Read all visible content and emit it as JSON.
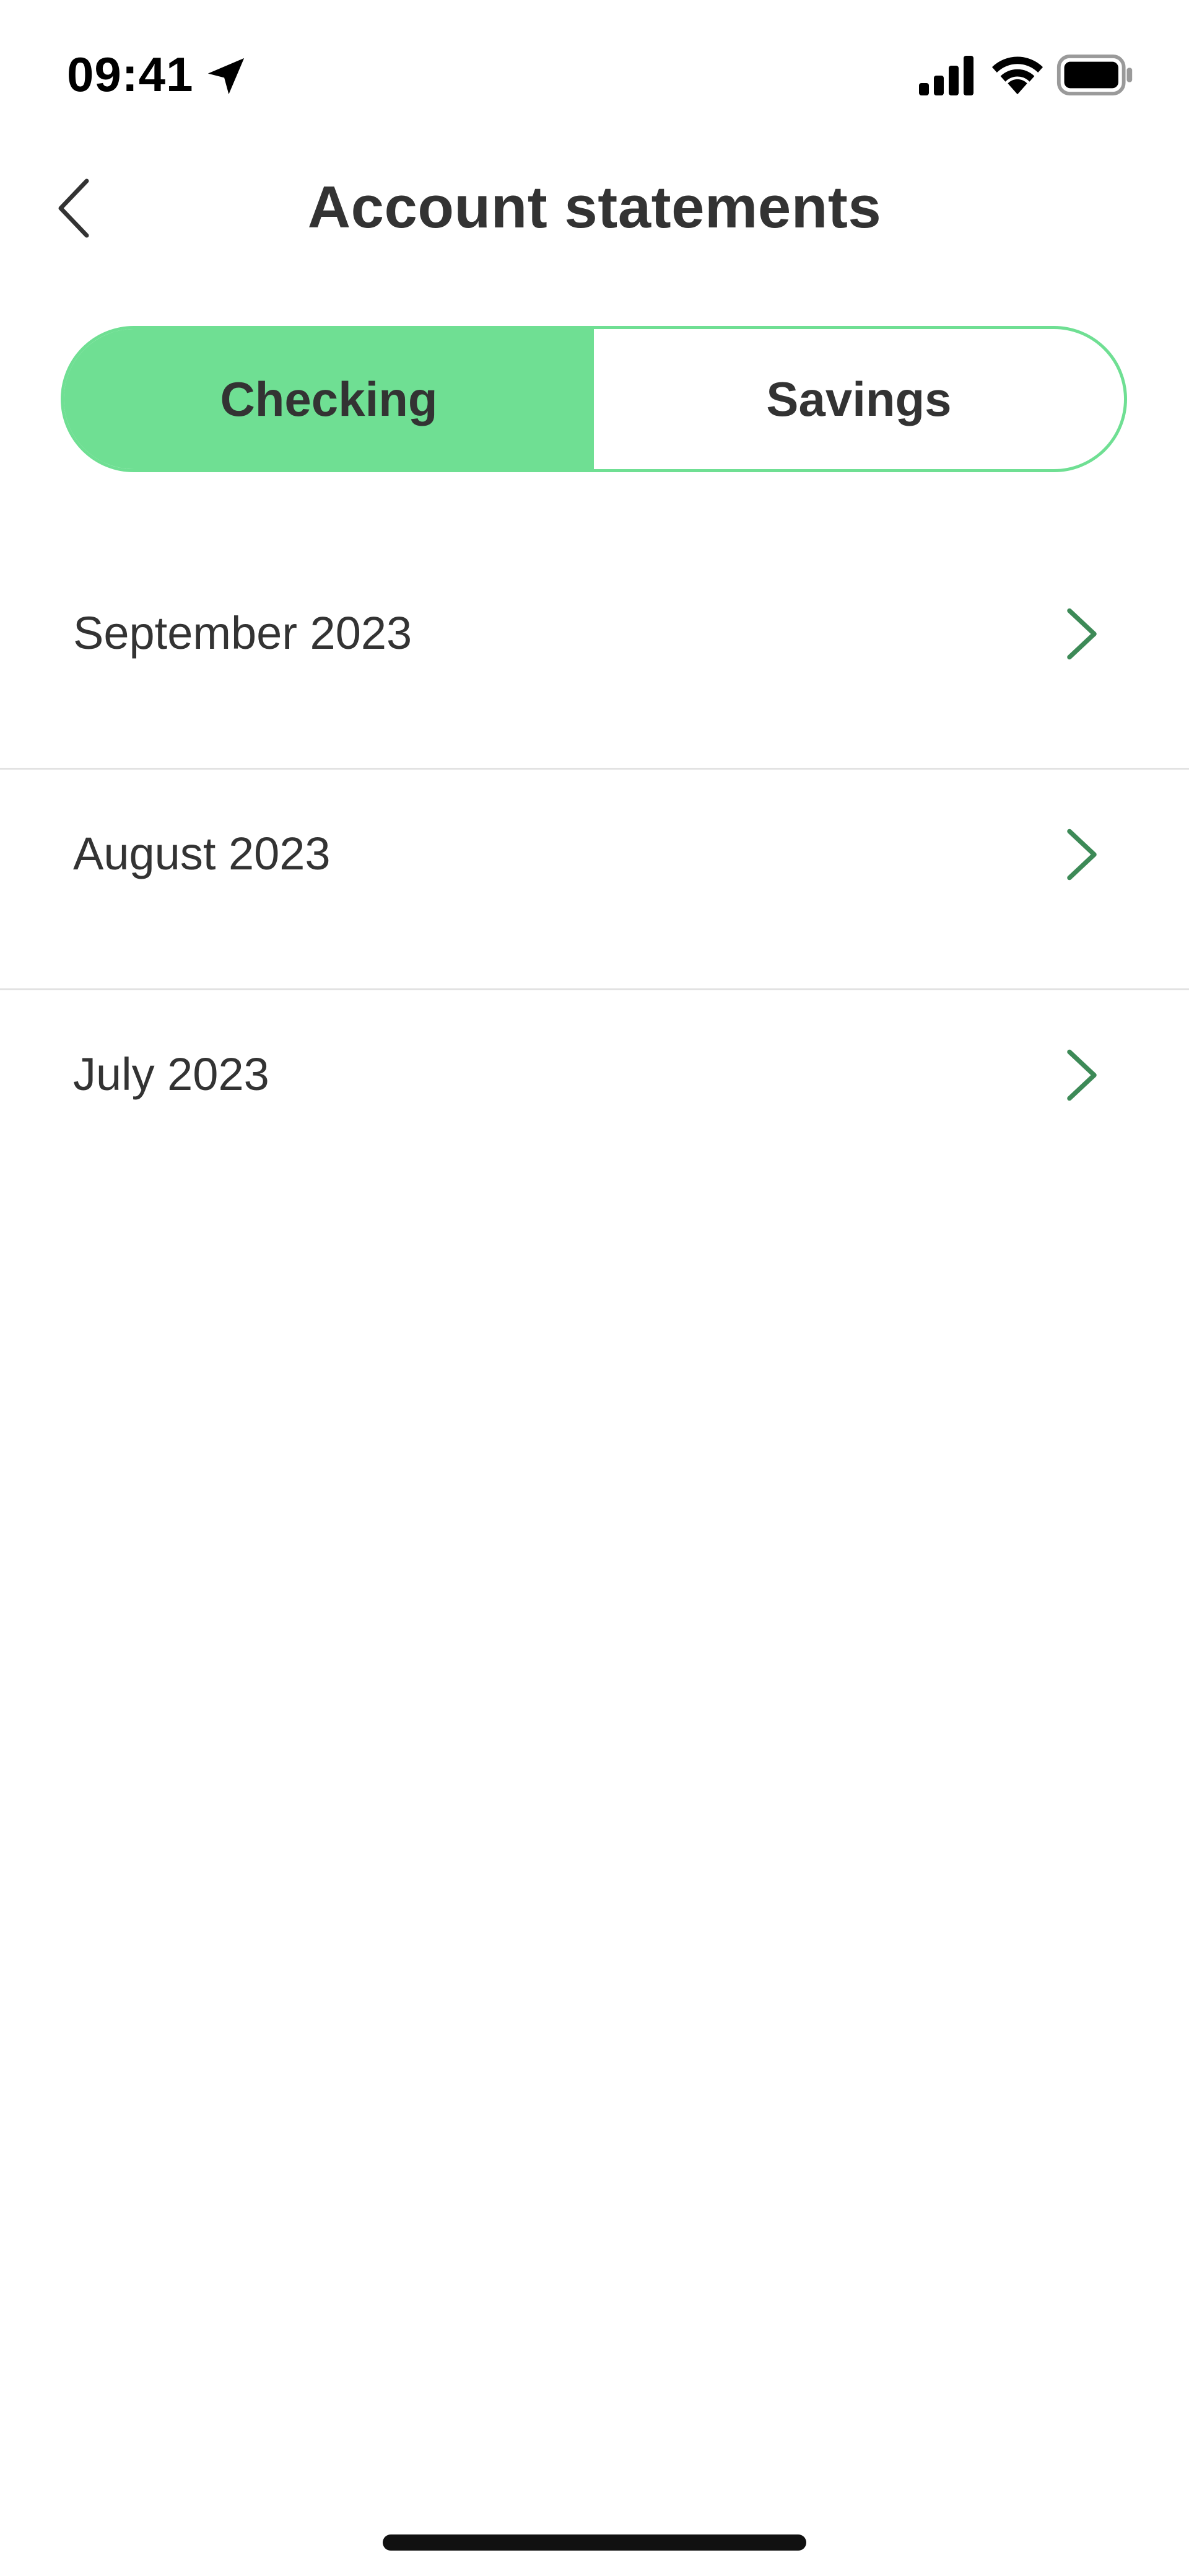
{
  "status_bar": {
    "time": "09:41",
    "icons": [
      "location-arrow-icon",
      "cellular-signal-icon",
      "wifi-icon",
      "battery-icon"
    ]
  },
  "header": {
    "title": "Account statements",
    "back_icon": "chevron-left-icon"
  },
  "tabs": [
    {
      "label": "Checking",
      "active": true
    },
    {
      "label": "Savings",
      "active": false
    }
  ],
  "statements": [
    {
      "label": "September 2023"
    },
    {
      "label": "August 2023"
    },
    {
      "label": "July 2023"
    }
  ],
  "colors": {
    "accent_green": "#6fdf93",
    "chevron_green": "#3d8a57",
    "text_dark": "#333333",
    "divider": "#e2e2e2"
  }
}
